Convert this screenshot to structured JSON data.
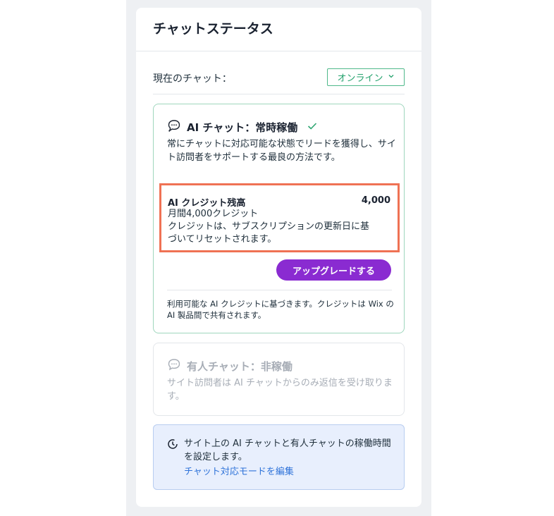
{
  "header": {
    "title": "チャットステータス"
  },
  "current_chat": {
    "label": "現在のチャット：",
    "selected": "オンライン"
  },
  "ai_chat": {
    "title": "AI チャット：常時稼働",
    "description": "常にチャットに対応可能な状態でリードを獲得し、サイト訪問者をサポートする最良の方法です。",
    "credits": {
      "title": "AI クレジット残高",
      "value": "4,000",
      "monthly": "月間4,000クレジット",
      "reset_note": "クレジットは、サブスクリプションの更新日に基づいてリセットされます。"
    },
    "upgrade_label": "アップグレードする",
    "footnote": "利用可能な AI クレジットに基づきます。クレジットは Wix の AI 製品間で共有されます。"
  },
  "human_chat": {
    "title": "有人チャット：非稼働",
    "description": "サイト訪問者は AI チャットからのみ返信を受け取ります。"
  },
  "info": {
    "text": "サイト上の AI チャットと有人チャットの稼働時間を設定します。",
    "link": "チャット対応モードを編集"
  },
  "colors": {
    "accent_green": "#25a26e",
    "upgrade_purple": "#8a2bd1",
    "highlight_orange": "#ef7254",
    "link_blue": "#2f73d9"
  },
  "icons": [
    "chat-sparkle-icon",
    "check-icon",
    "chevron-down-icon",
    "chat-bubble-icon",
    "clock-icon"
  ]
}
